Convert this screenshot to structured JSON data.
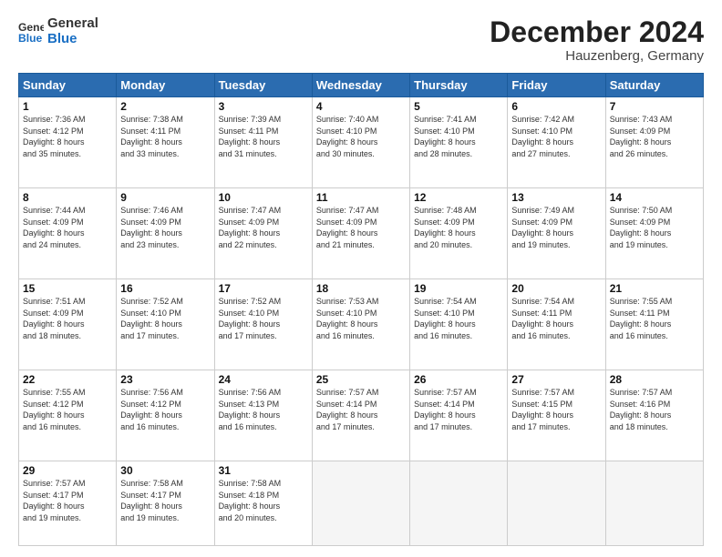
{
  "logo": {
    "line1": "General",
    "line2": "Blue"
  },
  "header": {
    "month": "December 2024",
    "location": "Hauzenberg, Germany"
  },
  "weekdays": [
    "Sunday",
    "Monday",
    "Tuesday",
    "Wednesday",
    "Thursday",
    "Friday",
    "Saturday"
  ],
  "days": [
    {
      "num": "",
      "info": ""
    },
    {
      "num": "",
      "info": ""
    },
    {
      "num": "",
      "info": ""
    },
    {
      "num": "",
      "info": ""
    },
    {
      "num": "",
      "info": ""
    },
    {
      "num": "",
      "info": ""
    },
    {
      "num": "7",
      "info": "Sunrise: 7:43 AM\nSunset: 4:09 PM\nDaylight: 8 hours\nand 26 minutes."
    },
    {
      "num": "1",
      "info": "Sunrise: 7:36 AM\nSunset: 4:12 PM\nDaylight: 8 hours\nand 35 minutes."
    },
    {
      "num": "2",
      "info": "Sunrise: 7:38 AM\nSunset: 4:11 PM\nDaylight: 8 hours\nand 33 minutes."
    },
    {
      "num": "3",
      "info": "Sunrise: 7:39 AM\nSunset: 4:11 PM\nDaylight: 8 hours\nand 31 minutes."
    },
    {
      "num": "4",
      "info": "Sunrise: 7:40 AM\nSunset: 4:10 PM\nDaylight: 8 hours\nand 30 minutes."
    },
    {
      "num": "5",
      "info": "Sunrise: 7:41 AM\nSunset: 4:10 PM\nDaylight: 8 hours\nand 28 minutes."
    },
    {
      "num": "6",
      "info": "Sunrise: 7:42 AM\nSunset: 4:10 PM\nDaylight: 8 hours\nand 27 minutes."
    },
    {
      "num": "7",
      "info": "Sunrise: 7:43 AM\nSunset: 4:09 PM\nDaylight: 8 hours\nand 26 minutes."
    },
    {
      "num": "8",
      "info": "Sunrise: 7:44 AM\nSunset: 4:09 PM\nDaylight: 8 hours\nand 24 minutes."
    },
    {
      "num": "9",
      "info": "Sunrise: 7:46 AM\nSunset: 4:09 PM\nDaylight: 8 hours\nand 23 minutes."
    },
    {
      "num": "10",
      "info": "Sunrise: 7:47 AM\nSunset: 4:09 PM\nDaylight: 8 hours\nand 22 minutes."
    },
    {
      "num": "11",
      "info": "Sunrise: 7:47 AM\nSunset: 4:09 PM\nDaylight: 8 hours\nand 21 minutes."
    },
    {
      "num": "12",
      "info": "Sunrise: 7:48 AM\nSunset: 4:09 PM\nDaylight: 8 hours\nand 20 minutes."
    },
    {
      "num": "13",
      "info": "Sunrise: 7:49 AM\nSunset: 4:09 PM\nDaylight: 8 hours\nand 19 minutes."
    },
    {
      "num": "14",
      "info": "Sunrise: 7:50 AM\nSunset: 4:09 PM\nDaylight: 8 hours\nand 19 minutes."
    },
    {
      "num": "15",
      "info": "Sunrise: 7:51 AM\nSunset: 4:09 PM\nDaylight: 8 hours\nand 18 minutes."
    },
    {
      "num": "16",
      "info": "Sunrise: 7:52 AM\nSunset: 4:10 PM\nDaylight: 8 hours\nand 17 minutes."
    },
    {
      "num": "17",
      "info": "Sunrise: 7:52 AM\nSunset: 4:10 PM\nDaylight: 8 hours\nand 17 minutes."
    },
    {
      "num": "18",
      "info": "Sunrise: 7:53 AM\nSunset: 4:10 PM\nDaylight: 8 hours\nand 16 minutes."
    },
    {
      "num": "19",
      "info": "Sunrise: 7:54 AM\nSunset: 4:10 PM\nDaylight: 8 hours\nand 16 minutes."
    },
    {
      "num": "20",
      "info": "Sunrise: 7:54 AM\nSunset: 4:11 PM\nDaylight: 8 hours\nand 16 minutes."
    },
    {
      "num": "21",
      "info": "Sunrise: 7:55 AM\nSunset: 4:11 PM\nDaylight: 8 hours\nand 16 minutes."
    },
    {
      "num": "22",
      "info": "Sunrise: 7:55 AM\nSunset: 4:12 PM\nDaylight: 8 hours\nand 16 minutes."
    },
    {
      "num": "23",
      "info": "Sunrise: 7:56 AM\nSunset: 4:12 PM\nDaylight: 8 hours\nand 16 minutes."
    },
    {
      "num": "24",
      "info": "Sunrise: 7:56 AM\nSunset: 4:13 PM\nDaylight: 8 hours\nand 16 minutes."
    },
    {
      "num": "25",
      "info": "Sunrise: 7:57 AM\nSunset: 4:14 PM\nDaylight: 8 hours\nand 17 minutes."
    },
    {
      "num": "26",
      "info": "Sunrise: 7:57 AM\nSunset: 4:14 PM\nDaylight: 8 hours\nand 17 minutes."
    },
    {
      "num": "27",
      "info": "Sunrise: 7:57 AM\nSunset: 4:15 PM\nDaylight: 8 hours\nand 17 minutes."
    },
    {
      "num": "28",
      "info": "Sunrise: 7:57 AM\nSunset: 4:16 PM\nDaylight: 8 hours\nand 18 minutes."
    },
    {
      "num": "29",
      "info": "Sunrise: 7:57 AM\nSunset: 4:17 PM\nDaylight: 8 hours\nand 19 minutes."
    },
    {
      "num": "30",
      "info": "Sunrise: 7:58 AM\nSunset: 4:17 PM\nDaylight: 8 hours\nand 19 minutes."
    },
    {
      "num": "31",
      "info": "Sunrise: 7:58 AM\nSunset: 4:18 PM\nDaylight: 8 hours\nand 20 minutes."
    }
  ]
}
